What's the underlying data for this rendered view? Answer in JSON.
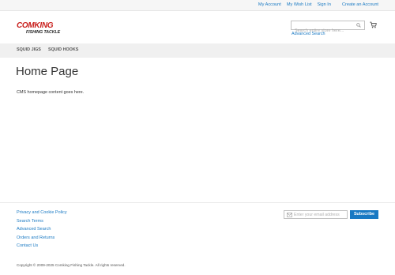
{
  "header": {
    "links": {
      "my_account": "My Account",
      "wish_list": "My Wish List",
      "sign_in": "Sign In",
      "create_account": "Create an Account"
    },
    "logo": {
      "line1": "COMKING",
      "line2": "FISHING TACKLE"
    },
    "search": {
      "placeholder": "Search entire store here...",
      "advanced_link": "Advanced Search"
    }
  },
  "nav": {
    "items": [
      {
        "label": "SQUID JIGS"
      },
      {
        "label": "SQUID HOOKS"
      }
    ]
  },
  "main": {
    "title": "Home Page",
    "content": "CMS homepage content goes here."
  },
  "footer": {
    "links": [
      {
        "label": "Privacy and Cookie Policy"
      },
      {
        "label": "Search Terms"
      },
      {
        "label": "Advanced Search"
      },
      {
        "label": "Orders and Returns"
      },
      {
        "label": "Contact Us"
      }
    ],
    "newsletter": {
      "placeholder": "Enter your email address",
      "button": "Subscribe"
    },
    "copyright": "Copyright © 2009-2025 Comking Fishing Tackle. All rights reserved."
  },
  "colors": {
    "link": "#1979c3",
    "brand_red": "#c9211e",
    "nav_bg": "#f0f0f0"
  }
}
